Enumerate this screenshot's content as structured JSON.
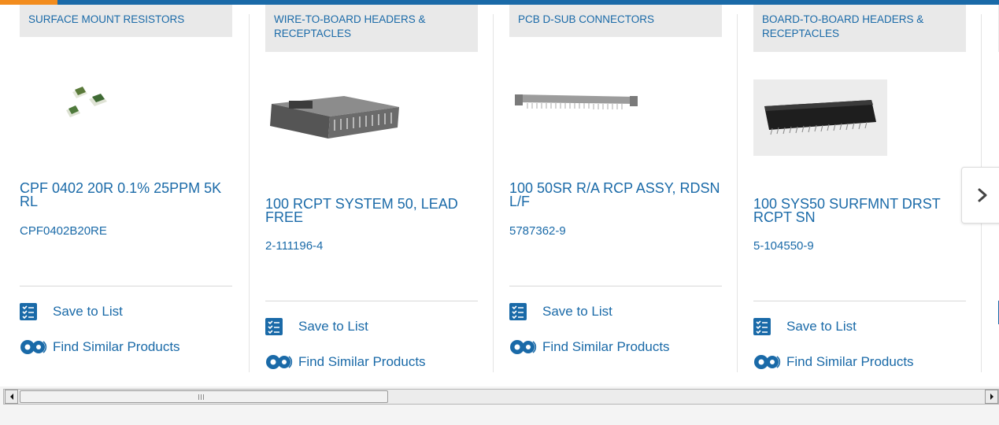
{
  "products": [
    {
      "category": "SURFACE MOUNT RESISTORS",
      "name": "CPF 0402 20R 0.1% 25PPM 5K RL",
      "part_number": "CPF0402B20RE",
      "image": "smd-resistor-image"
    },
    {
      "category": "WIRE-TO-BOARD HEADERS & RECEPTACLES",
      "name": "100 RCPT SYSTEM 50, LEAD FREE",
      "part_number": "2-111196-4",
      "image": "connector-housing-image"
    },
    {
      "category": "PCB D-SUB CONNECTORS",
      "name": "100 50SR R/A RCP ASSY, RDSN L/F",
      "part_number": "5787362-9",
      "image": "dsub-connector-image"
    },
    {
      "category": "BOARD-TO-BOARD HEADERS & RECEPTACLES",
      "name": "100 SYS50 SURFMNT DRST RCPT SN",
      "part_number": "5-104550-9",
      "image": "board-connector-image"
    }
  ],
  "actions": {
    "save_label": "Save to List",
    "similar_label": "Find Similar Products"
  },
  "icons": {
    "save": "checklist-icon",
    "similar": "gears-icon",
    "next": "chevron-right-icon"
  },
  "colors": {
    "link": "#1a6aa8",
    "accent": "#f28c1e",
    "category_bg": "#e9e9e9"
  }
}
